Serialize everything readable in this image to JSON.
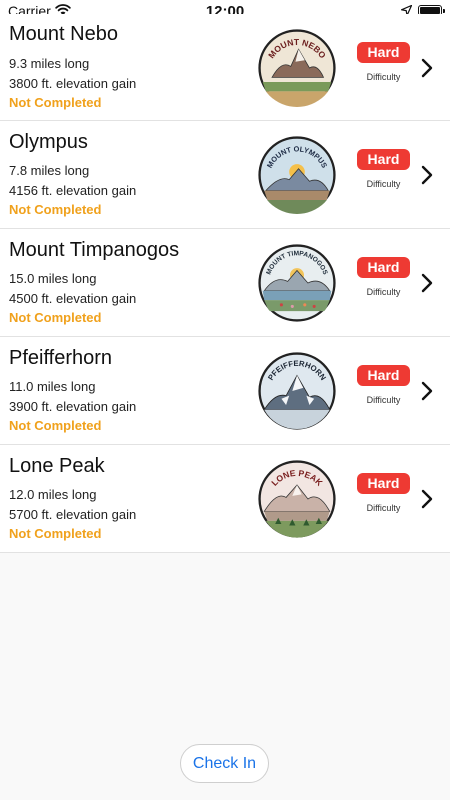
{
  "status_bar": {
    "carrier": "Carrier",
    "time": "12:00"
  },
  "trails": [
    {
      "name": "Mount Nebo",
      "length": "9.3 miles long",
      "gain": "3800 ft. elevation gain",
      "status": "Not Completed",
      "difficulty": "Hard",
      "difficulty_caption": "Difficulty",
      "badge_text": "MOUNT NEBO"
    },
    {
      "name": "Olympus",
      "length": "7.8 miles long",
      "gain": "4156 ft. elevation gain",
      "status": "Not Completed",
      "difficulty": "Hard",
      "difficulty_caption": "Difficulty",
      "badge_text": "MOUNT OLYMPUS"
    },
    {
      "name": "Mount Timpanogos",
      "length": "15.0 miles long",
      "gain": "4500 ft. elevation gain",
      "status": "Not Completed",
      "difficulty": "Hard",
      "difficulty_caption": "Difficulty",
      "badge_text": "MOUNT TIMPANOGOS"
    },
    {
      "name": "Pfeifferhorn",
      "length": "11.0 miles long",
      "gain": "3900 ft. elevation gain",
      "status": "Not Completed",
      "difficulty": "Hard",
      "difficulty_caption": "Difficulty",
      "badge_text": "PFEIFFERHORN"
    },
    {
      "name": "Lone Peak",
      "length": "12.0 miles long",
      "gain": "5700 ft. elevation gain",
      "status": "Not Completed",
      "difficulty": "Hard",
      "difficulty_caption": "Difficulty",
      "badge_text": "LONE PEAK"
    }
  ],
  "check_in_label": "Check In",
  "colors": {
    "status": "#f0a11c",
    "difficulty": "#ee3a33",
    "link": "#1a73e8"
  }
}
